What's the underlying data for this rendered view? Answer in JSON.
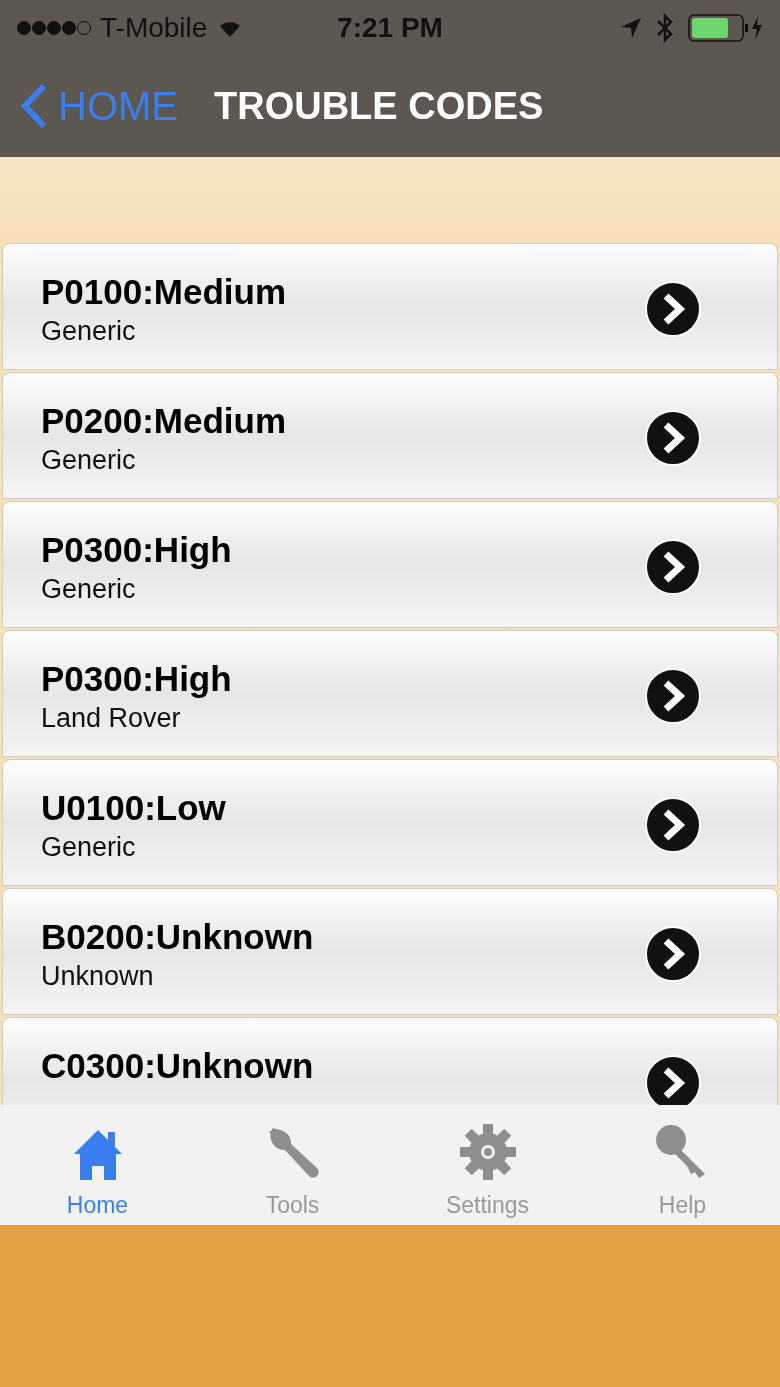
{
  "status_bar": {
    "carrier": "T-Mobile",
    "time": "7:21 PM"
  },
  "nav_bar": {
    "back": "HOME",
    "title": "TROUBLE CODES"
  },
  "codes": [
    {
      "code": "P0100:Medium",
      "make": "Generic"
    },
    {
      "code": "P0200:Medium",
      "make": "Generic"
    },
    {
      "code": "P0300:High",
      "make": "Generic"
    },
    {
      "code": "P0300:High",
      "make": "Land Rover"
    },
    {
      "code": "U0100:Low",
      "make": "Generic"
    },
    {
      "code": "B0200:Unknown",
      "make": "Unknown"
    },
    {
      "code": "C0300:Unknown"
    }
  ],
  "tab_bar": [
    {
      "kind": "home",
      "label": "Home",
      "selected": true
    },
    {
      "kind": "tools",
      "label": "Tools",
      "selected": false
    },
    {
      "kind": "settings",
      "label": "Settings",
      "selected": false
    },
    {
      "kind": "help",
      "label": "Help",
      "selected": false
    }
  ]
}
